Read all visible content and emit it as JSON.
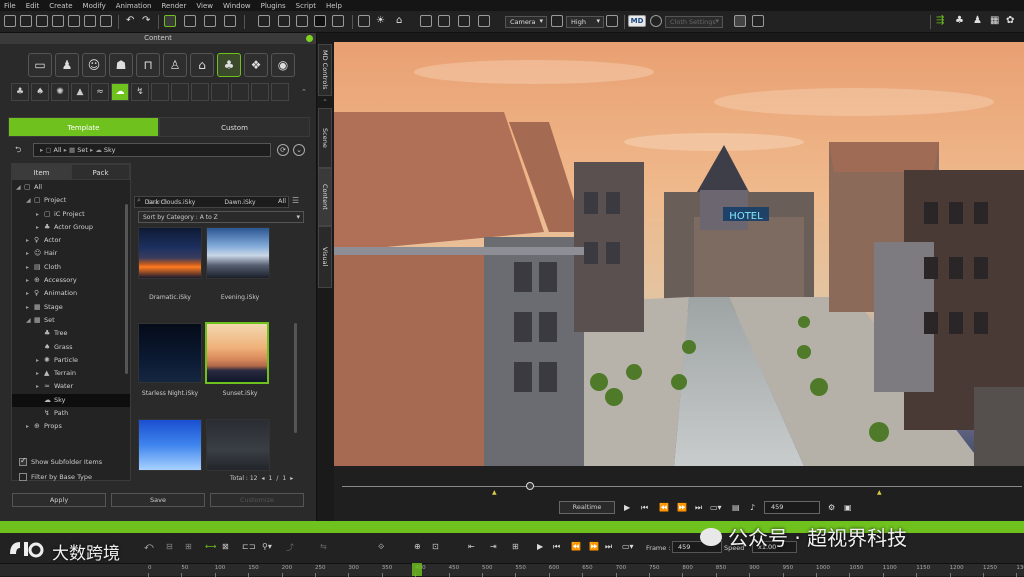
{
  "menu": [
    "File",
    "Edit",
    "Create",
    "Modify",
    "Animation",
    "Render",
    "View",
    "Window",
    "Plugins",
    "Script",
    "Help"
  ],
  "toolbar": {
    "camera_label": "Camera",
    "quality_label": "High",
    "md_label": "MD",
    "cloth_placeholder": "Cloth Settings"
  },
  "content_panel": {
    "title": "Content",
    "tabs": [
      {
        "label": "Template",
        "active": true
      },
      {
        "label": "Custom",
        "active": false
      }
    ],
    "path": [
      "All",
      "Set",
      "Sky"
    ],
    "subtabs": [
      {
        "label": "Item"
      },
      {
        "label": "Pack"
      }
    ],
    "tree": [
      {
        "label": "All",
        "indent": 0,
        "icon": "▢"
      },
      {
        "label": "Project",
        "indent": 1,
        "icon": "▢"
      },
      {
        "label": "iC Project",
        "indent": 2,
        "icon": "▢"
      },
      {
        "label": "Actor Group",
        "indent": 2,
        "icon": "♣"
      },
      {
        "label": "Actor",
        "indent": 1,
        "icon": "♀"
      },
      {
        "label": "Hair",
        "indent": 1,
        "icon": "☺"
      },
      {
        "label": "Cloth",
        "indent": 1,
        "icon": "▤"
      },
      {
        "label": "Accessory",
        "indent": 1,
        "icon": "⊕"
      },
      {
        "label": "Animation",
        "indent": 1,
        "icon": "♀"
      },
      {
        "label": "Stage",
        "indent": 1,
        "icon": "▦"
      },
      {
        "label": "Set",
        "indent": 1,
        "icon": "▦"
      },
      {
        "label": "Tree",
        "indent": 2,
        "icon": "♣"
      },
      {
        "label": "Grass",
        "indent": 2,
        "icon": "♠"
      },
      {
        "label": "Particle",
        "indent": 2,
        "icon": "✺"
      },
      {
        "label": "Terrain",
        "indent": 2,
        "icon": "▲"
      },
      {
        "label": "Water",
        "indent": 2,
        "icon": "≈"
      },
      {
        "label": "Sky",
        "indent": 2,
        "icon": "☁",
        "selected": true
      },
      {
        "label": "Path",
        "indent": 2,
        "icon": "↯"
      },
      {
        "label": "Props",
        "indent": 1,
        "icon": "⊕"
      }
    ],
    "search_placeholder": "Search",
    "search_filter": "All",
    "sort_label": "Sort by Category : A to Z",
    "items": [
      {
        "label": "Dark Clouds.iSky"
      },
      {
        "label": "Dawn.iSky"
      },
      {
        "label": "Dramatic.iSky"
      },
      {
        "label": "Evening.iSky"
      },
      {
        "label": "Starless Night.iSky"
      },
      {
        "label": "Sunset.iSky"
      }
    ],
    "total_label": "Total : 12",
    "page_current": "1",
    "page_sep": "/",
    "page_total": "1",
    "show_subfolder": "Show Subfolder Items",
    "filter_base": "Filter by Base Type",
    "apply": "Apply",
    "save": "Save",
    "customize": "Customize"
  },
  "side_tabs": [
    "MD Controls",
    "Scene",
    "Content",
    "Visual"
  ],
  "playback": {
    "realtime": "Realtime",
    "frame": "459"
  },
  "timeline": {
    "frame_label": "Frame :",
    "frame_value": "459",
    "speed_label": "Speed",
    "speed_value": "x1.00",
    "ruler": [
      "0",
      "50",
      "100",
      "150",
      "200",
      "250",
      "300",
      "350",
      "400",
      "450",
      "500",
      "550",
      "600",
      "650",
      "700",
      "750",
      "800",
      "850",
      "900",
      "950",
      "1000",
      "1050",
      "1100",
      "1150",
      "1200",
      "1250",
      "1300"
    ]
  },
  "watermark": {
    "left": "大数跨境",
    "right": "公众号 · 超视界科技"
  },
  "viewport_sign": "HOTEL"
}
